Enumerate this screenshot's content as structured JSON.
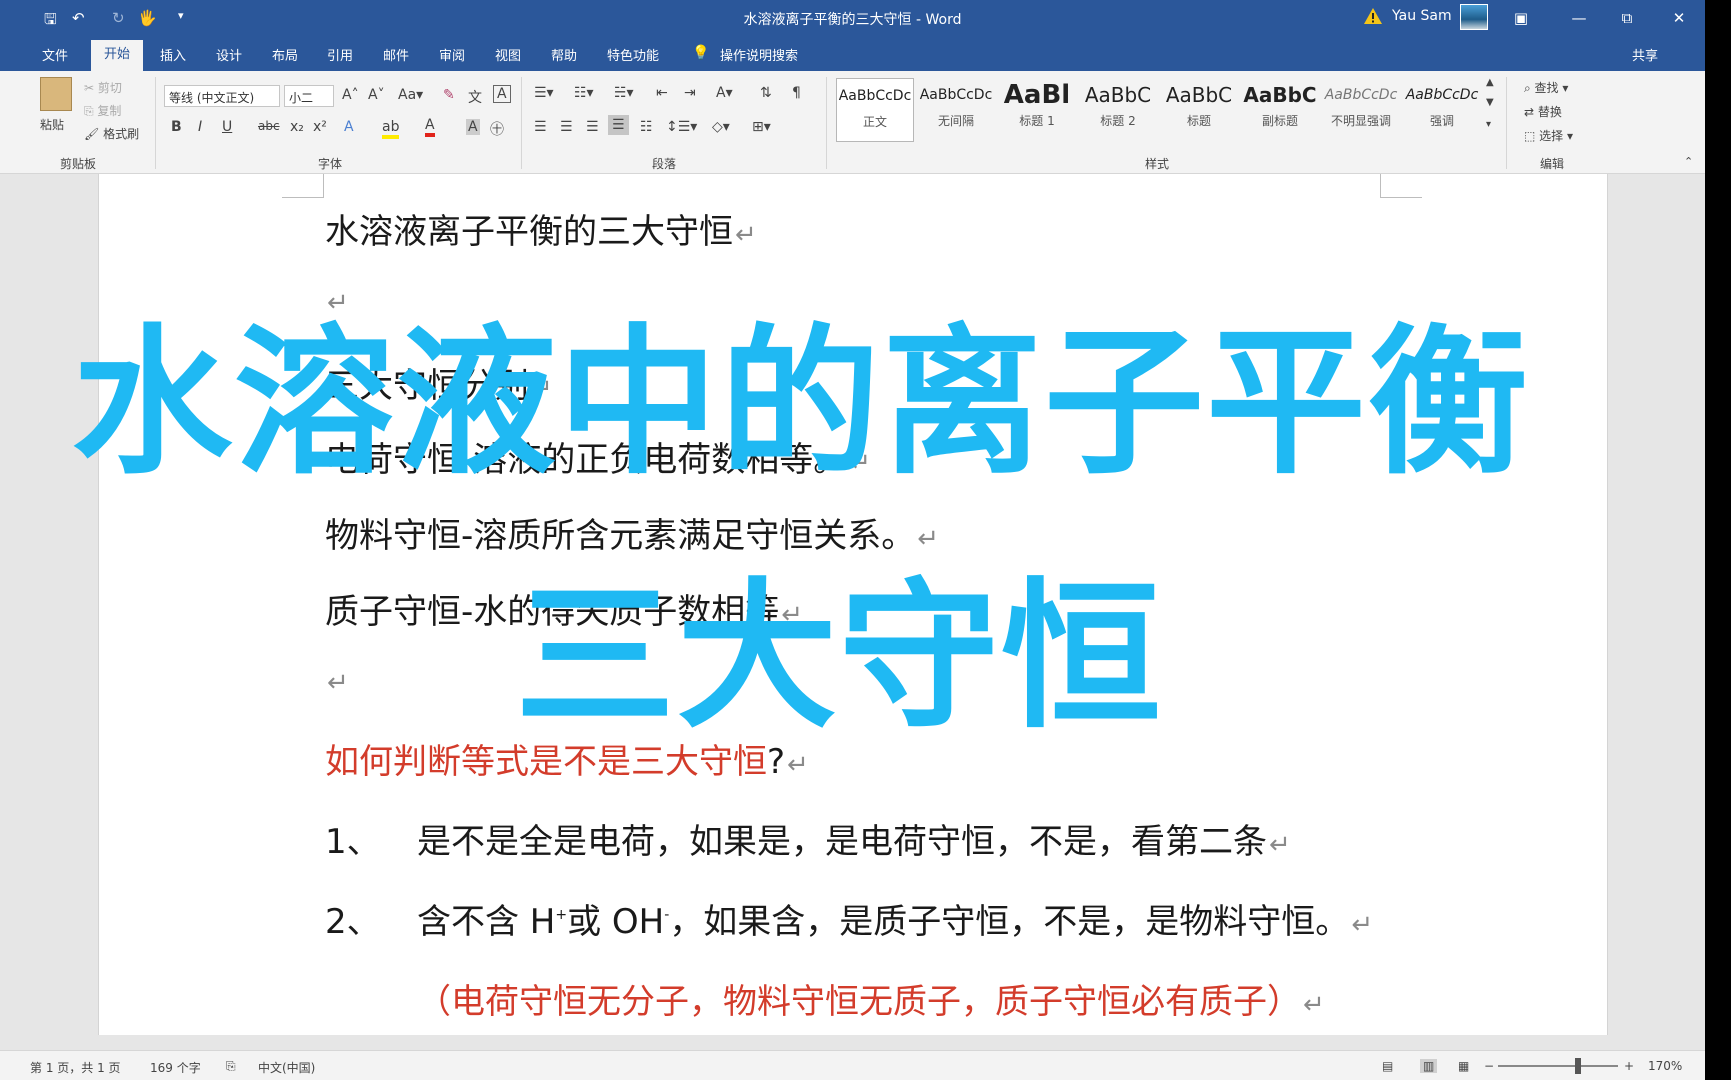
{
  "window": {
    "title": "水溶液离子平衡的三大守恒 - Word",
    "user": "Yau Sam",
    "controls": [
      "▣",
      "—",
      "⧉",
      "✕"
    ]
  },
  "quick_access": [
    "🖫",
    "↶",
    "↻",
    "🖐",
    "▾"
  ],
  "tabs": [
    "文件",
    "开始",
    "插入",
    "设计",
    "布局",
    "引用",
    "邮件",
    "审阅",
    "视图",
    "帮助",
    "特色功能",
    "操作说明搜索"
  ],
  "share_label": "共享",
  "ribbon": {
    "clipboard": {
      "paste": "粘贴",
      "cut": "剪切",
      "copy": "复制",
      "format_painter": "格式刷",
      "label": "剪贴板"
    },
    "font": {
      "font_name": "等线 (中文正文)",
      "font_size": "小二",
      "label": "字体"
    },
    "paragraph": {
      "label": "段落"
    },
    "styles": {
      "label": "样式",
      "items": [
        {
          "sample": "AaBbCcDc",
          "name": "正文"
        },
        {
          "sample": "AaBbCcDc",
          "name": "无间隔"
        },
        {
          "sample": "AaBl",
          "name": "标题 1"
        },
        {
          "sample": "AaBbC",
          "name": "标题 2"
        },
        {
          "sample": "AaBbC",
          "name": "标题"
        },
        {
          "sample": "AaBbC",
          "name": "副标题"
        },
        {
          "sample": "AaBbCcDc",
          "name": "不明显强调"
        },
        {
          "sample": "AaBbCcDc",
          "name": "强调"
        }
      ]
    },
    "editing": {
      "find": "查找",
      "replace": "替换",
      "select": "选择",
      "label": "编辑"
    }
  },
  "document": {
    "title": "水溶液离子平衡的三大守恒",
    "line2": "三大守恒分别",
    "line3": "电荷守恒-溶液的正负电荷数相等。",
    "line4": "物料守恒-溶质所含元素满足守恒关系。",
    "line5": "质子守恒-水的得失质子数相等",
    "question": "如何判断等式是不是三大守恒",
    "question_mark": "?",
    "item1_num": "1、",
    "item1_text": "是不是全是电荷，如果是，是电荷守恒，不是，看第二条",
    "item2_num": "2、",
    "item2_pre": "含不含 H",
    "item2_sup1": "+",
    "item2_mid": "或 OH",
    "item2_sup2": "-",
    "item2_post": "，如果含，是质子守恒，不是，是物料守恒。",
    "note": "（电荷守恒无分子，物料守恒无质子，质子守恒必有质子）",
    "pilcrow": "↵"
  },
  "overlay": {
    "line1": "水溶液中的离子平衡",
    "line2": "三大守恒",
    "color": "#1fb9f3"
  },
  "status": {
    "page": "第 1 页，共 1 页",
    "words": "169 个字",
    "language": "中文(中国)",
    "zoom": "170%",
    "zoom_level": 170
  }
}
